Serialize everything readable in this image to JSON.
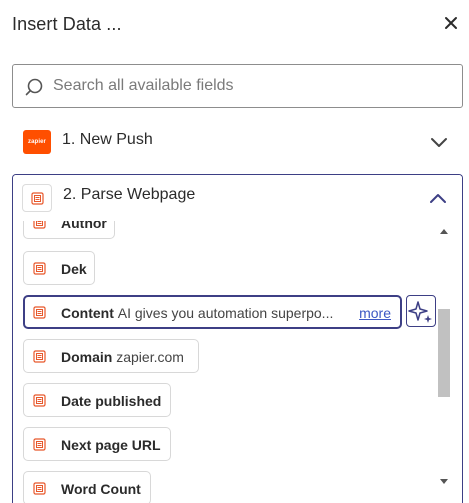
{
  "header": {
    "title": "Insert Data ..."
  },
  "search": {
    "placeholder": "Search all available fields",
    "value": ""
  },
  "steps": [
    {
      "label": "1. New Push",
      "app": "zapier",
      "expanded": false
    },
    {
      "label": "2. Parse Webpage",
      "expanded": true
    }
  ],
  "fields": [
    {
      "name": "Author",
      "value": ""
    },
    {
      "name": "Dek",
      "value": ""
    },
    {
      "name": "Content",
      "value": "AI gives you automation superpo...",
      "more": "more"
    },
    {
      "name": "Domain",
      "value": "zapier.com"
    },
    {
      "name": "Date published",
      "value": ""
    },
    {
      "name": "Next page URL",
      "value": ""
    },
    {
      "name": "Word Count",
      "value": ""
    }
  ],
  "colors": {
    "accent": "#3d3f85",
    "zapier_orange": "#ff4f00",
    "doc_icon": "#e8572a",
    "link": "#3d58c4"
  }
}
